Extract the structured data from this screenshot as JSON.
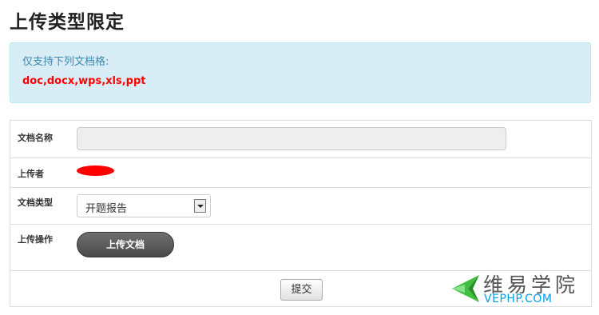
{
  "page": {
    "title": "上传类型限定"
  },
  "info": {
    "label": "仅支持下列文档格:",
    "types": "doc,docx,wps,xls,ppt"
  },
  "form": {
    "doc_name": {
      "label": "文档名称",
      "value": "",
      "placeholder": ""
    },
    "uploader": {
      "label": "上传者"
    },
    "doc_type": {
      "label": "文档类型",
      "selected": "开题报告"
    },
    "upload_action": {
      "label": "上传操作",
      "button_label": "上传文档"
    },
    "submit_label": "提交"
  },
  "watermark": {
    "brand_cn": "维易学院",
    "brand_en": "VEPHP.COM"
  },
  "colors": {
    "info_bg": "#d9edf7",
    "info_text": "#3a87ad",
    "types_text": "#ff0000",
    "redaction": "#ff0000",
    "upload_button_bg": "#555555",
    "watermark_green": "#3fbf3f",
    "watermark_blue": "#00a0e8"
  }
}
